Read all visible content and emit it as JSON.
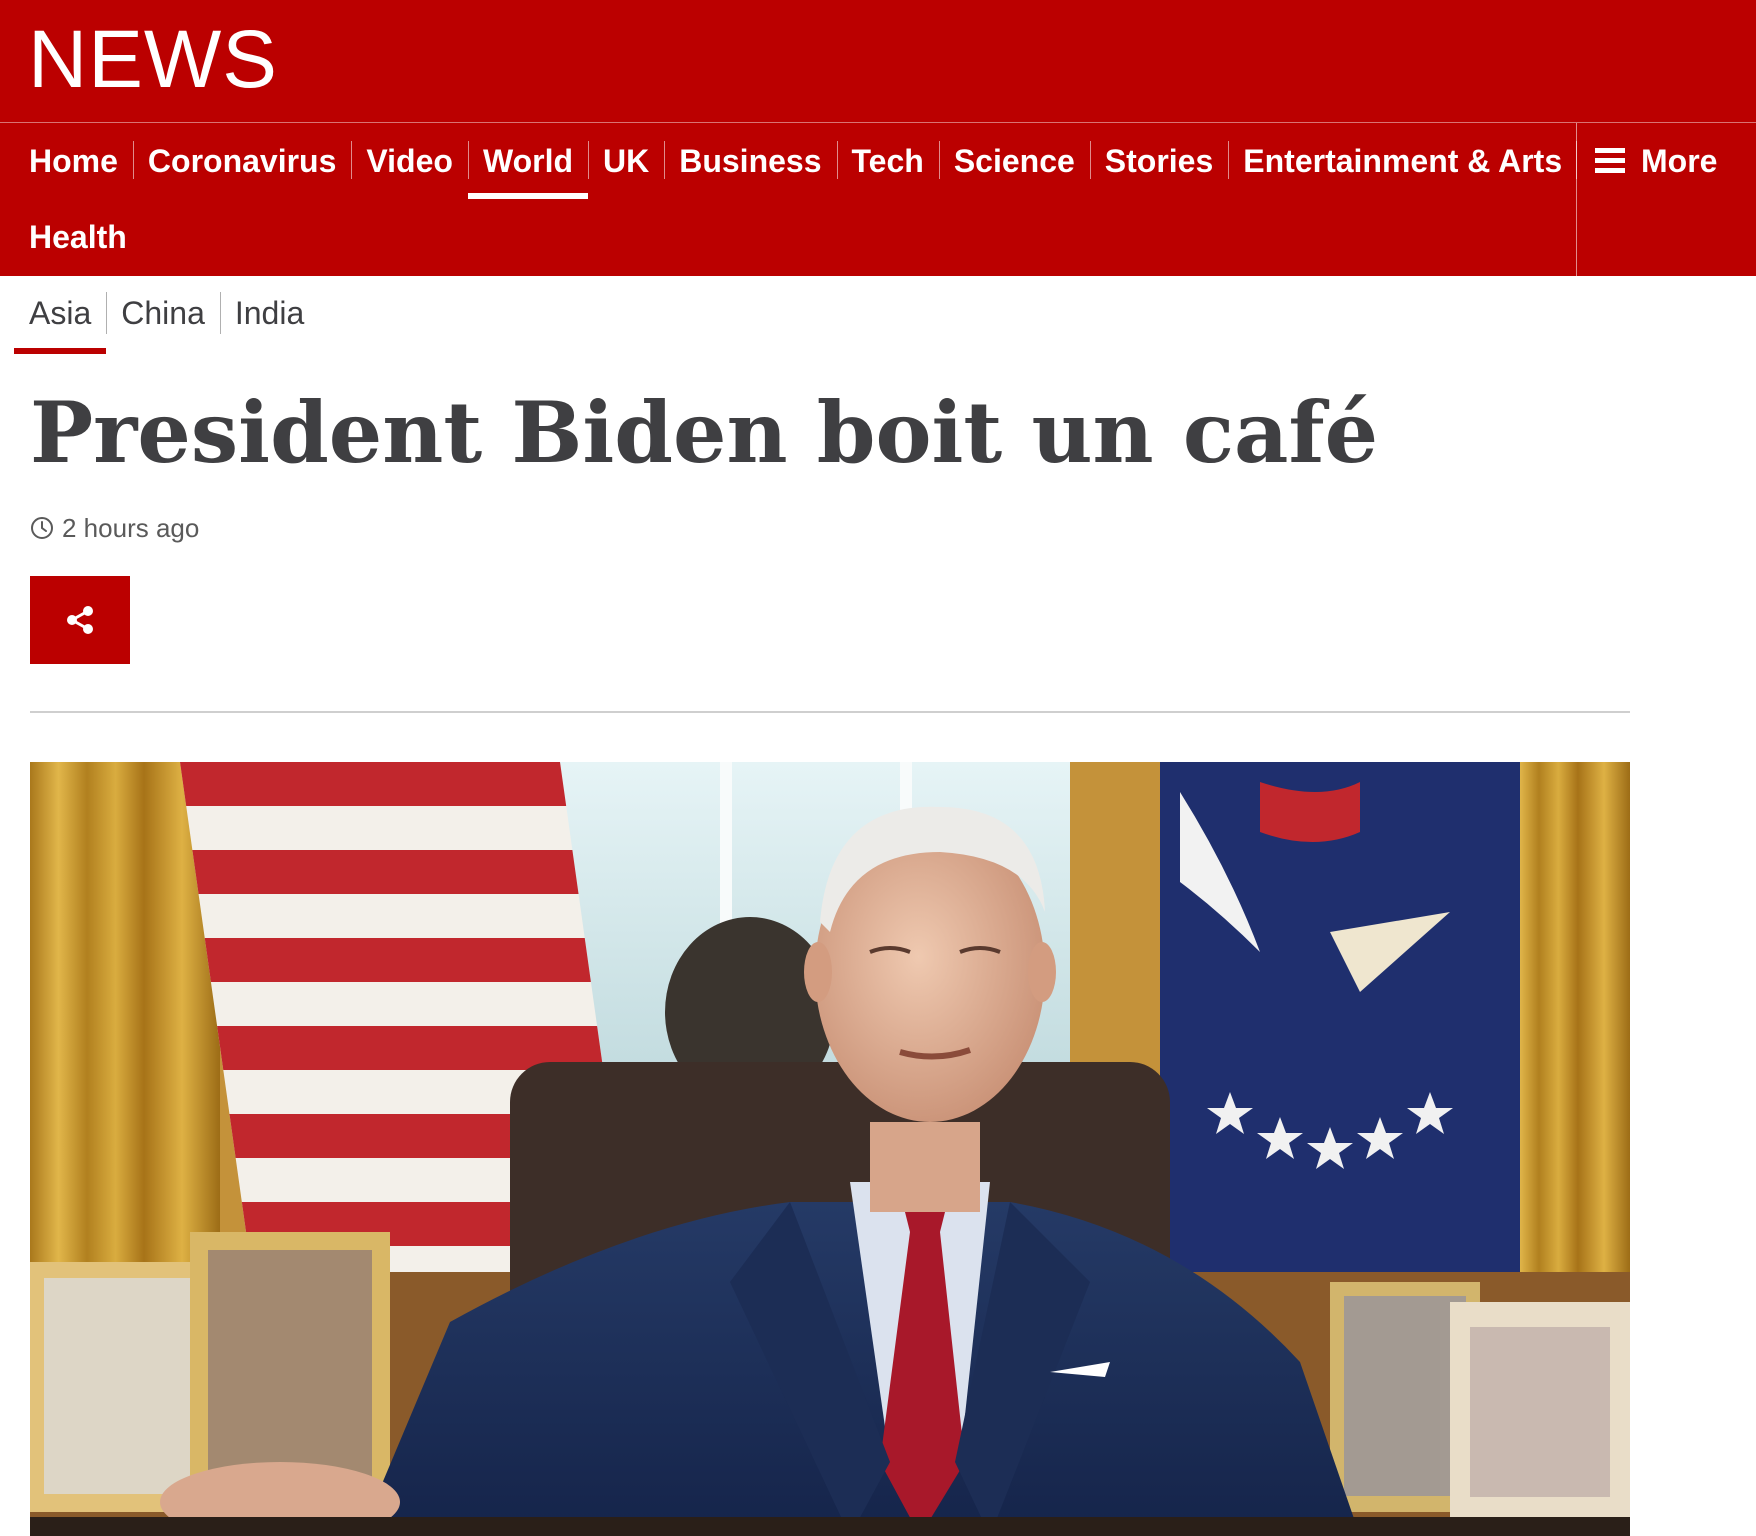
{
  "header": {
    "logo": "NEWS"
  },
  "nav": {
    "items": [
      {
        "label": "Home"
      },
      {
        "label": "Coronavirus"
      },
      {
        "label": "Video"
      },
      {
        "label": "World",
        "active": true
      },
      {
        "label": "UK"
      },
      {
        "label": "Business"
      },
      {
        "label": "Tech"
      },
      {
        "label": "Science"
      },
      {
        "label": "Stories"
      },
      {
        "label": "Entertainment & Arts"
      },
      {
        "label": "Health"
      }
    ],
    "more_label": "More"
  },
  "subnav": {
    "items": [
      {
        "label": "Asia",
        "active": true
      },
      {
        "label": "China"
      },
      {
        "label": "India"
      }
    ]
  },
  "article": {
    "headline": "President Biden boit un café",
    "timestamp": "2 hours ago",
    "share_icon": "share-icon",
    "image_icon": "photo"
  },
  "colors": {
    "brand": "#bb0000",
    "headline": "#3f3f42",
    "rule": "#cfcfcf"
  }
}
